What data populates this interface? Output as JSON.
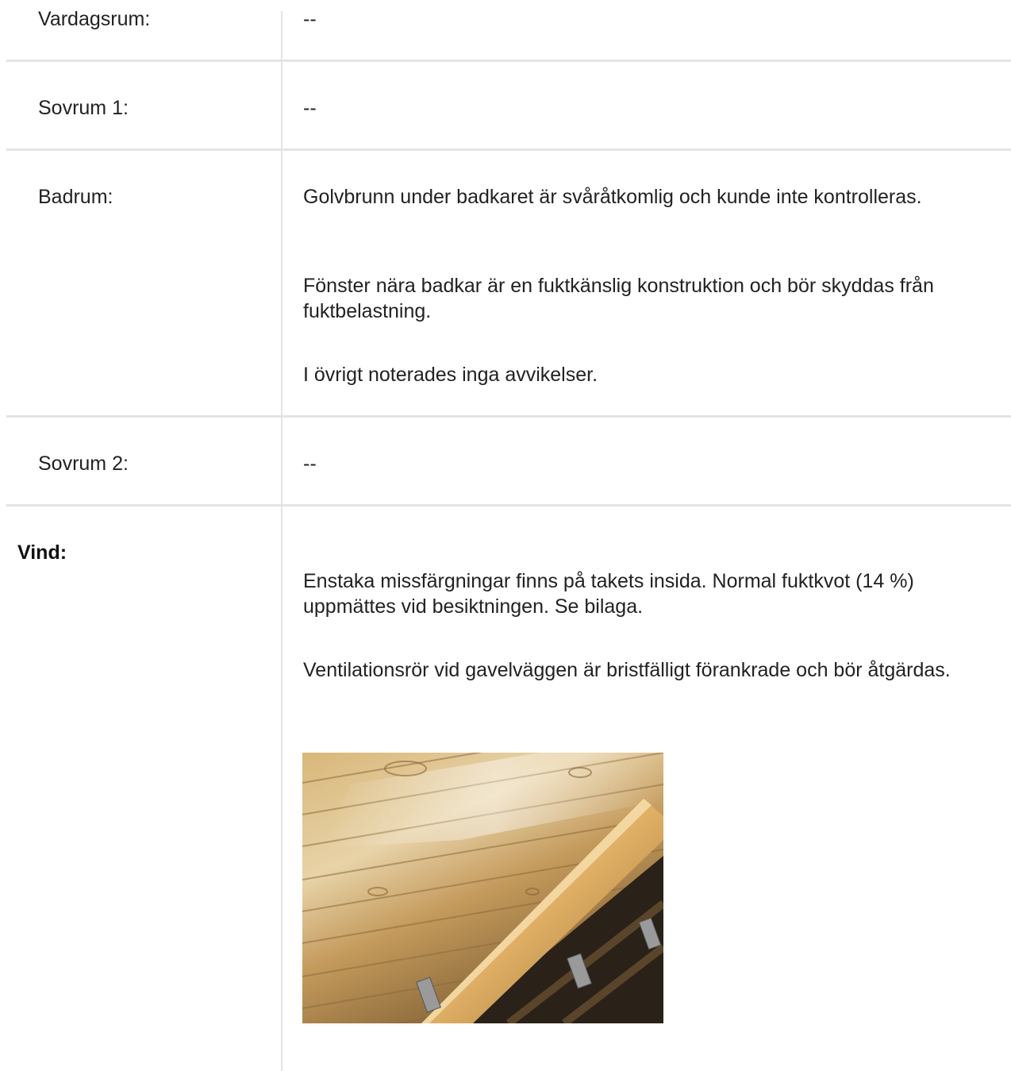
{
  "rows": [
    {
      "label": "Vardagsrum:",
      "value": "--"
    },
    {
      "label": "Sovrum 1:",
      "value": "--"
    },
    {
      "label": "Badrum:",
      "paragraphs": [
        "Golvbrunn under badkaret är svåråtkomlig och kunde inte kontrolleras.",
        "Fönster nära badkar är en fuktkänslig konstruktion och bör skyddas från fuktbelastning.",
        "I övrigt noterades inga avvikelser."
      ]
    },
    {
      "label": "Sovrum 2:",
      "value": "--"
    },
    {
      "label": "Vind:",
      "paragraphs": [
        "Enstaka missfärgningar finns på takets insida. Normal fuktkvot (14 %) uppmättes vid besiktningen. Se bilaga.",
        "Ventilationsrör vid gavelväggen är bristfälligt förankrade och bör åtgärdas."
      ]
    }
  ]
}
